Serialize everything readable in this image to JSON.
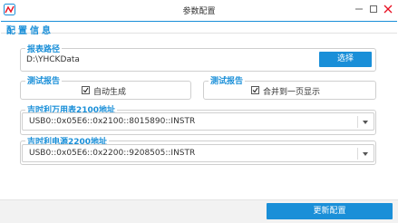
{
  "window": {
    "title": "参数配置"
  },
  "section": {
    "title": "配置信息"
  },
  "report_path": {
    "label": "报表路径",
    "value": "D:\\YHCKData",
    "button_label": "选择"
  },
  "test_report_left": {
    "label": "测试报告",
    "checkbox_label": "自动生成",
    "checked": true
  },
  "test_report_right": {
    "label": "测试报告",
    "checkbox_label": "合并到一页显示",
    "checked": true
  },
  "multimeter": {
    "label": "吉时利万用表2100地址",
    "value": "USB0::0x05E6::0x2100::8015890::INSTR"
  },
  "power_supply": {
    "label": "吉时利电源2200地址",
    "value": "USB0::0x05E6::0x2200::9208505::INSTR"
  },
  "footer": {
    "update_button_label": "更新配置"
  },
  "colors": {
    "accent": "#1a8fd8",
    "close_icon": "#e81123"
  }
}
